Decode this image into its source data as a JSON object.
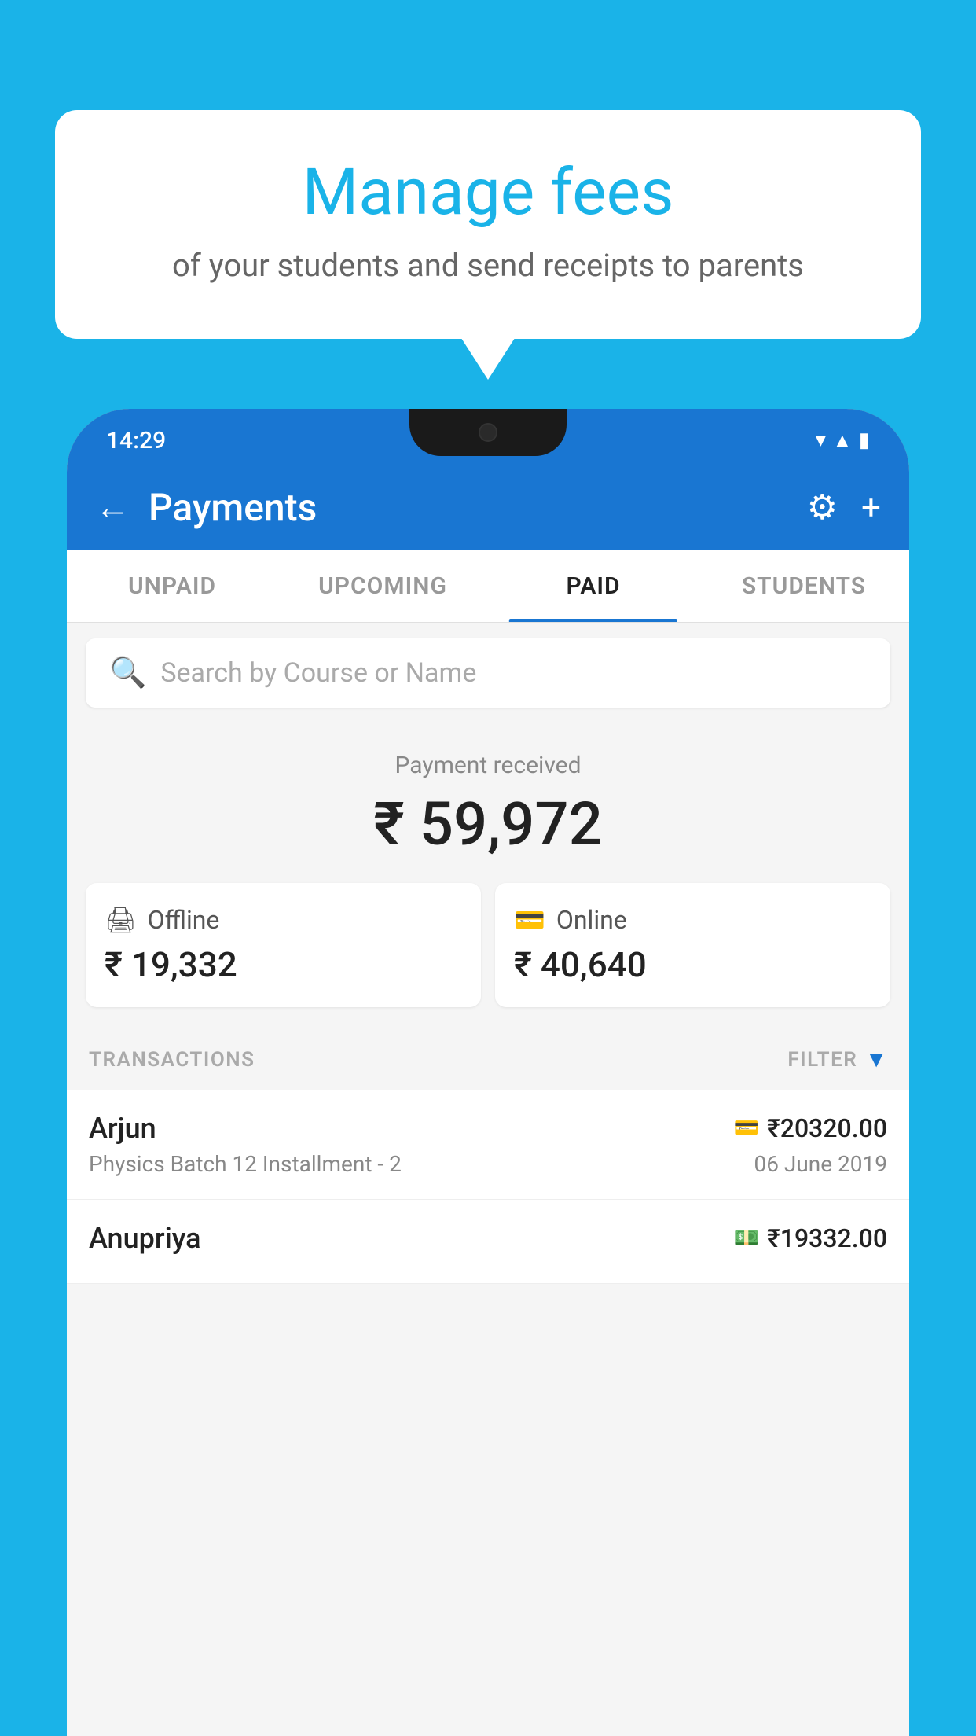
{
  "background_color": "#1ab3e8",
  "bubble": {
    "title": "Manage fees",
    "subtitle": "of your students and send receipts to parents"
  },
  "phone": {
    "status_bar": {
      "time": "14:29"
    },
    "app_bar": {
      "title": "Payments",
      "back_label": "←",
      "gear_unicode": "⚙",
      "plus_unicode": "+"
    },
    "tabs": [
      {
        "label": "UNPAID",
        "active": false
      },
      {
        "label": "UPCOMING",
        "active": false
      },
      {
        "label": "PAID",
        "active": true
      },
      {
        "label": "STUDENTS",
        "active": false
      }
    ],
    "search": {
      "placeholder": "Search by Course or Name"
    },
    "payment_summary": {
      "label": "Payment received",
      "amount": "₹ 59,972"
    },
    "payment_cards": [
      {
        "icon": "💵",
        "type": "Offline",
        "amount": "₹ 19,332"
      },
      {
        "icon": "💳",
        "type": "Online",
        "amount": "₹ 40,640"
      }
    ],
    "transactions_label": "TRANSACTIONS",
    "filter_label": "FILTER",
    "transactions": [
      {
        "name": "Arjun",
        "method_icon": "💳",
        "amount": "₹20320.00",
        "course": "Physics Batch 12 Installment - 2",
        "date": "06 June 2019"
      },
      {
        "name": "Anupriya",
        "method_icon": "💵",
        "amount": "₹19332.00",
        "course": "",
        "date": ""
      }
    ]
  }
}
